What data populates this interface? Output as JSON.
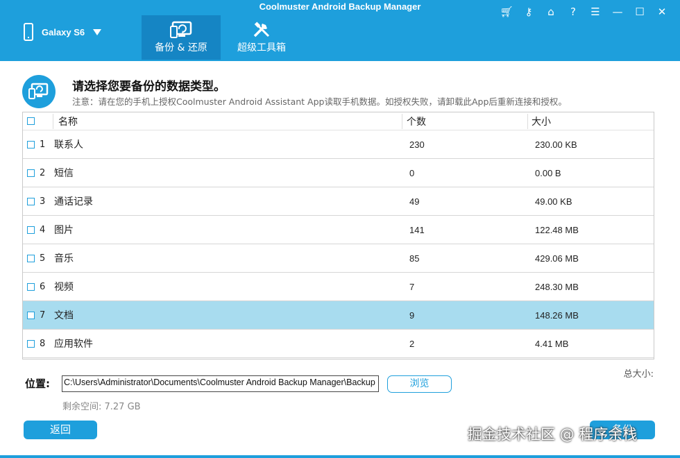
{
  "app": {
    "title": "Coolmuster Android Backup Manager"
  },
  "device": {
    "name": "Galaxy S6"
  },
  "tabs": [
    {
      "label": "备份 & 还原",
      "icon": "backup-restore-icon",
      "active": true
    },
    {
      "label": "超级工具箱",
      "icon": "tools-icon",
      "active": false
    }
  ],
  "window_controls": [
    "cart-icon",
    "key-icon",
    "home-icon",
    "help-icon",
    "feedback-icon",
    "minimize-icon",
    "maximize-icon",
    "close-icon"
  ],
  "header": {
    "title": "请选择您要备份的数据类型。",
    "note": "注意：请在您的手机上授权Coolmuster Android Assistant App读取手机数据。如授权失败，请卸载此App后重新连接和授权。"
  },
  "table": {
    "columns": {
      "name": "名称",
      "count": "个数",
      "size": "大小"
    },
    "rows": [
      {
        "index": "1",
        "name": "联系人",
        "count": "230",
        "size": "230.00 KB"
      },
      {
        "index": "2",
        "name": "短信",
        "count": "0",
        "size": "0.00 B"
      },
      {
        "index": "3",
        "name": "通话记录",
        "count": "49",
        "size": "49.00 KB"
      },
      {
        "index": "4",
        "name": "图片",
        "count": "141",
        "size": "122.48 MB"
      },
      {
        "index": "5",
        "name": "音乐",
        "count": "85",
        "size": "429.06 MB"
      },
      {
        "index": "6",
        "name": "视频",
        "count": "7",
        "size": "248.30 MB"
      },
      {
        "index": "7",
        "name": "文档",
        "count": "9",
        "size": "148.26 MB"
      },
      {
        "index": "8",
        "name": "应用软件",
        "count": "2",
        "size": "4.41 MB"
      }
    ],
    "selected_row": "7"
  },
  "footer": {
    "total_label": "总大小:",
    "location_label": "位置:",
    "path": "C:\\Users\\Administrator\\Documents\\Coolmuster Android Backup Manager\\Backup",
    "browse_label": "浏览",
    "free_space": "剩余空间: 7.27 GB",
    "back_label": "返回",
    "backup_label": "备份"
  },
  "watermark": "掘金技术社区 @ 程序余栈",
  "colors": {
    "accent": "#1e9fdc",
    "tab_active": "#1585c4",
    "row_selected": "#a8dcef"
  }
}
